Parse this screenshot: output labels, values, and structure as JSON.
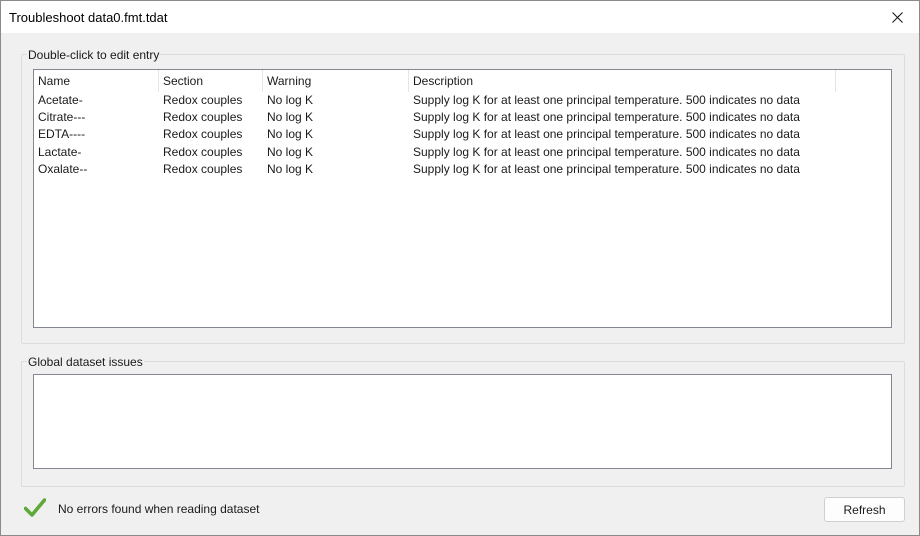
{
  "window": {
    "title": "Troubleshoot data0.fmt.tdat",
    "close_icon": "close-icon"
  },
  "entries_group": {
    "title": "Double-click to edit entry",
    "columns": [
      "Name",
      "Section",
      "Warning",
      "Description",
      ""
    ],
    "rows": [
      {
        "name": "Acetate-",
        "section": "Redox couples",
        "warning": "No log K",
        "description": "Supply log K for at least one principal temperature. 500 indicates no data"
      },
      {
        "name": "Citrate---",
        "section": "Redox couples",
        "warning": "No log K",
        "description": "Supply log K for at least one principal temperature. 500 indicates no data"
      },
      {
        "name": "EDTA----",
        "section": "Redox couples",
        "warning": "No log K",
        "description": "Supply log K for at least one principal temperature. 500 indicates no data"
      },
      {
        "name": "Lactate-",
        "section": "Redox couples",
        "warning": "No log K",
        "description": "Supply log K for at least one principal temperature. 500 indicates no data"
      },
      {
        "name": "Oxalate--",
        "section": "Redox couples",
        "warning": "No log K",
        "description": "Supply log K for at least one principal temperature. 500 indicates no data"
      }
    ]
  },
  "global_group": {
    "title": "Global dataset issues"
  },
  "status": {
    "icon": "checkmark-icon",
    "icon_color": "#5fa83a",
    "text": "No errors found when reading dataset"
  },
  "buttons": {
    "refresh_label": "Refresh"
  }
}
